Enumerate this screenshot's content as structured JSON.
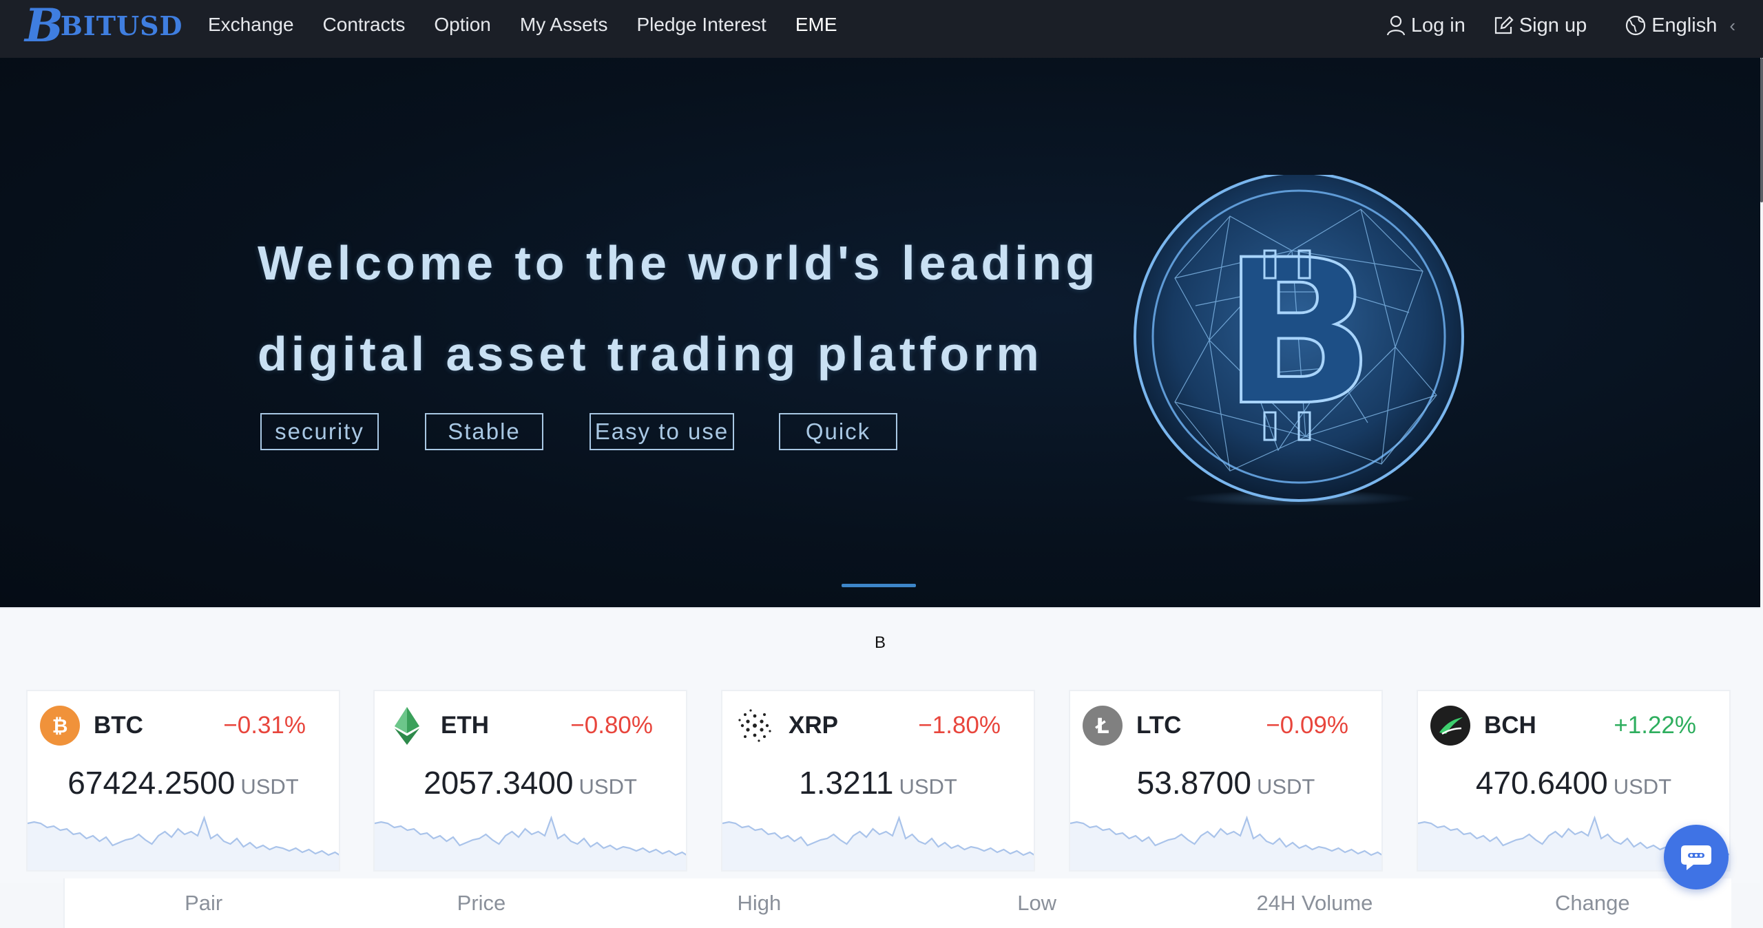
{
  "brand": {
    "logo_mark": "B",
    "name": "BITUSD"
  },
  "nav": {
    "items": [
      {
        "label": "Exchange"
      },
      {
        "label": "Contracts"
      },
      {
        "label": "Option"
      },
      {
        "label": "My Assets"
      },
      {
        "label": "Pledge Interest"
      },
      {
        "label": "EME"
      }
    ],
    "login": "Log in",
    "signup": "Sign up",
    "language": "English",
    "icons": {
      "login": "user-icon",
      "signup": "edit-icon",
      "language": "globe-icon",
      "chevron": "chevron-left-icon"
    }
  },
  "hero": {
    "title_line1": "Welcome to the world's leading",
    "title_line2": "digital asset trading platform",
    "tags": [
      "security",
      "Stable",
      "Easy to use",
      "Quick"
    ],
    "image": "bitcoin-coin-illustration"
  },
  "notice": {
    "text": "B"
  },
  "tickers": [
    {
      "symbol": "BTC",
      "change": "−0.31%",
      "direction": "down",
      "price": "67424.2500",
      "unit": "USDT",
      "icon": "bitcoin-icon",
      "color": "#f0923a"
    },
    {
      "symbol": "ETH",
      "change": "−0.80%",
      "direction": "down",
      "price": "2057.3400",
      "unit": "USDT",
      "icon": "ethereum-icon",
      "color": "#3aa05a"
    },
    {
      "symbol": "XRP",
      "change": "−1.80%",
      "direction": "down",
      "price": "1.3211",
      "unit": "USDT",
      "icon": "xrp-icon",
      "color": "#222222"
    },
    {
      "symbol": "LTC",
      "change": "−0.09%",
      "direction": "down",
      "price": "53.8700",
      "unit": "USDT",
      "icon": "litecoin-icon",
      "color": "#808080"
    },
    {
      "symbol": "BCH",
      "change": "+1.22%",
      "direction": "up",
      "price": "470.6400",
      "unit": "USDT",
      "icon": "bitcoin-cash-icon",
      "color": "#1e1e1e"
    }
  ],
  "market_table": {
    "headers": [
      "Pair",
      "Price",
      "High",
      "Low",
      "24H Volume",
      "Change"
    ]
  },
  "colors": {
    "nav_bg": "#1b1f27",
    "accent": "#3f73e5",
    "down": "#e8453c",
    "up": "#2eae5e",
    "hero_bg": "#07111d"
  },
  "chat_button": {
    "icon": "chat-bubble-icon"
  }
}
